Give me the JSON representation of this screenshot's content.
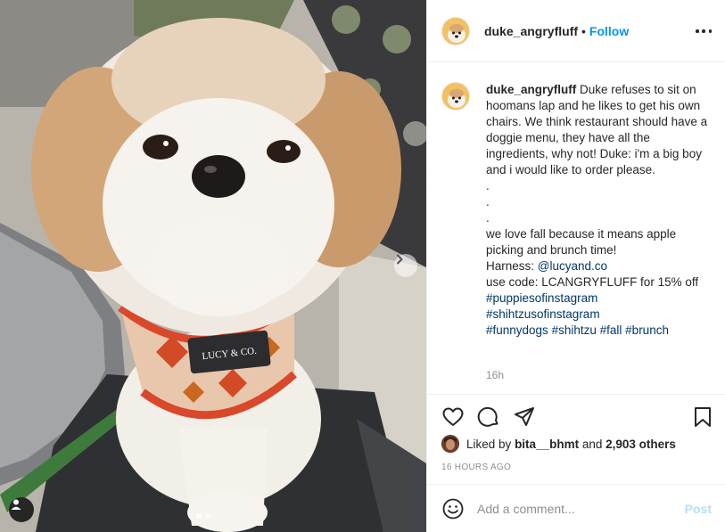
{
  "post": {
    "author": "duke_angryfluff",
    "header_separator": "•",
    "follow_label": "Follow",
    "caption": {
      "username": "duke_angryfluff",
      "lines": [
        "Duke refuses to sit on hoomans lap and he likes to get his own chairs. We think restaurant should have a doggie menu, they have all the ingredients, why not! Duke: i'm a big boy and i would like to order please.",
        ".",
        ".",
        ".",
        "we love fall because it means apple picking and brunch time!"
      ],
      "harness_label": "Harness: ",
      "harness_handle": "@lucyand.co",
      "code_text": "use code: LCANGRYFLUFF for 15% off",
      "hashtags": [
        "#puppiesofinstagram",
        "#shihtzusofinstagram",
        "#funnydogs",
        "#shihtzu",
        "#fall",
        "#brunch"
      ],
      "age": "16h"
    },
    "likes": {
      "prefix": "Liked by ",
      "user": "bita__bhmt",
      "middle": " and ",
      "count": "2,903 others"
    },
    "timestamp": "16 HOURS AGO",
    "comment": {
      "placeholder": "Add a comment...",
      "post_label": "Post"
    },
    "photo": {
      "harness_brand": "LUCY & CO.",
      "carousel_index": 1,
      "carousel_total": 2
    },
    "icons": [
      "heart-icon",
      "comment-icon",
      "share-icon",
      "bookmark-icon",
      "emoji-icon",
      "more-icon",
      "chevron-right-icon",
      "user-tag-icon"
    ],
    "colors": {
      "follow": "#0095f6",
      "link": "#00376b",
      "muted": "#8e8e8e",
      "post_disabled": "#b2dffc"
    }
  }
}
